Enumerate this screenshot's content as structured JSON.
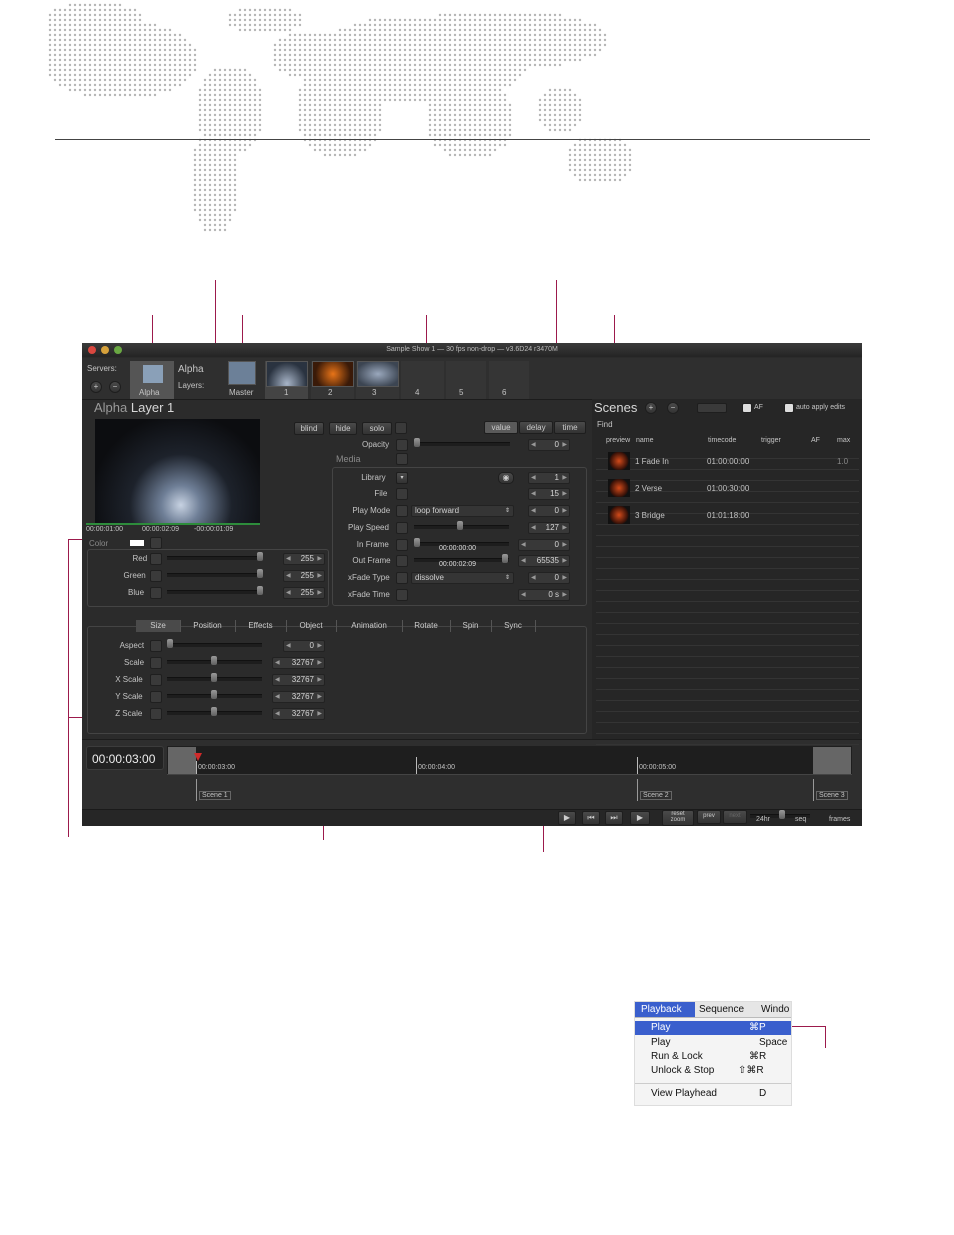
{
  "app": {
    "title": "Sample Show 1  —  30 fps non-drop  —  v3.6D24 r3470M",
    "servers_label": "Servers:",
    "server_name": "Alpha",
    "server_tab_label": "Alpha",
    "layers_label": "Layers:",
    "master_label": "Master",
    "layer_numbers": [
      "1",
      "2",
      "3",
      "4",
      "5",
      "6"
    ],
    "layer_title_name": "Alpha",
    "layer_title_rest": "Layer 1",
    "buttons": {
      "blind": "blind",
      "hide": "hide",
      "solo": "solo",
      "value": "value",
      "delay": "delay",
      "time": "time"
    },
    "preview_times": {
      "t1": "00:00:01:00",
      "t2": "00:00:02:09",
      "t3": "-00:00:01:09"
    },
    "color": {
      "label": "Color",
      "rows": [
        {
          "label": "Red",
          "value": "255"
        },
        {
          "label": "Green",
          "value": "255"
        },
        {
          "label": "Blue",
          "value": "255"
        }
      ]
    },
    "media": {
      "opacity_label": "Opacity",
      "opacity_value": "0",
      "media_label": "Media",
      "library_label": "Library",
      "library_value": "1",
      "file_label": "File",
      "file_value": "15",
      "playmode_label": "Play Mode",
      "playmode_select": "loop forward",
      "playmode_value": "0",
      "playspeed_label": "Play Speed",
      "playspeed_value": "127",
      "inframe_label": "In Frame",
      "inframe_time": "00:00:00:00",
      "inframe_value": "0",
      "outframe_label": "Out Frame",
      "outframe_time": "00:00:02:09",
      "outframe_value": "65535",
      "xfadetype_label": "xFade Type",
      "xfadetype_select": "dissolve",
      "xfadetype_value": "0",
      "xfadetime_label": "xFade Time",
      "xfadetime_value": "0 s"
    },
    "tabs": [
      "Size",
      "Position",
      "Effects",
      "Object",
      "Animation",
      "Rotate",
      "Spin",
      "Sync"
    ],
    "size_rows": [
      {
        "label": "Aspect",
        "value": "0"
      },
      {
        "label": "Scale",
        "value": "32767"
      },
      {
        "label": "X Scale",
        "value": "32767"
      },
      {
        "label": "Y Scale",
        "value": "32767"
      },
      {
        "label": "Z Scale",
        "value": "32767"
      }
    ],
    "scenes": {
      "title": "Scenes",
      "af_label": "AF",
      "auto_apply_label": "auto apply edits",
      "find_label": "Find",
      "columns": {
        "preview": "preview",
        "name": "name",
        "timecode": "timecode",
        "trigger": "trigger",
        "af": "AF",
        "max": "max"
      },
      "rows": [
        {
          "name": "1 Fade In",
          "timecode": "01:00:00:00",
          "max": "1.0"
        },
        {
          "name": "2 Verse",
          "timecode": "01:00:30:00",
          "max": ""
        },
        {
          "name": "3 Bridge",
          "timecode": "01:01:18:00",
          "max": ""
        }
      ]
    },
    "timeline": {
      "current_time": "00:00:03:00",
      "ticks": [
        "00:00:03:00",
        "00:00:04:00",
        "00:00:05:00"
      ],
      "cues": [
        "Scene 1",
        "Scene 2",
        "Scene 3"
      ]
    },
    "transport": {
      "reset_zoom": "reset\nzoom",
      "prev": "prev",
      "next": "next",
      "fps24": "24hr",
      "seq": "seq",
      "frames": "frames"
    }
  },
  "menu": {
    "bar": [
      "Playback",
      "Sequence",
      "Windo"
    ],
    "items": [
      {
        "label": "Play",
        "shortcut": "⌘P",
        "highlighted": true
      },
      {
        "label": "Play",
        "shortcut": "Space",
        "highlighted": false
      },
      {
        "label": "Run & Lock",
        "shortcut": "⌘R",
        "highlighted": false
      },
      {
        "label": "Unlock & Stop",
        "shortcut": "⇧⌘R",
        "highlighted": false
      },
      {
        "label": "View Playhead",
        "shortcut": "D",
        "highlighted": false
      }
    ],
    "highlight_color": "#3a5fcd"
  },
  "colors": {
    "callout": "#9c1a4c",
    "app_bg": "#2b2b2b"
  }
}
